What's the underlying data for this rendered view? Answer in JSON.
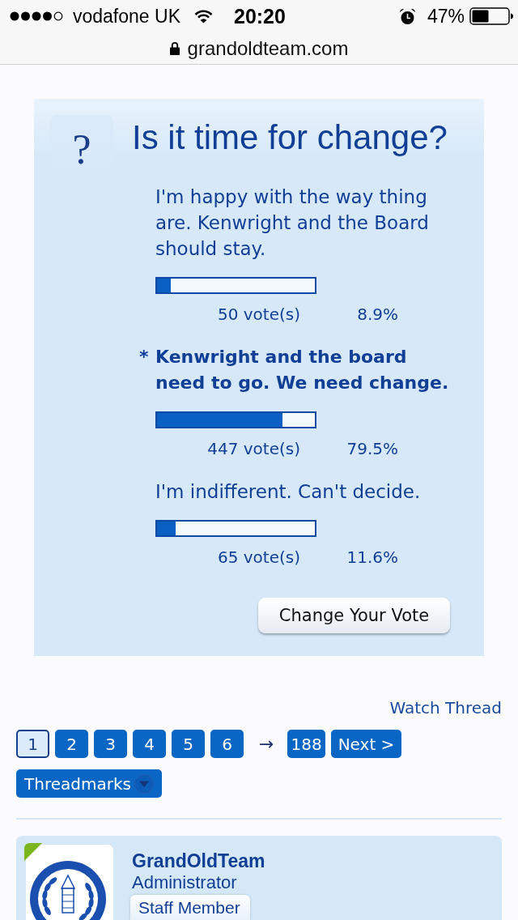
{
  "status_bar": {
    "carrier": "vodafone UK",
    "time": "20:20",
    "battery": "47%"
  },
  "address_bar": {
    "url": "grandoldteam.com"
  },
  "poll": {
    "icon": "?",
    "title": "Is it time for change?",
    "voted_marker": "*",
    "options": [
      {
        "text": "I'm happy with the way thing are. Kenwright and the Board should stay.",
        "selected": false,
        "level": 0.089,
        "votes": "50 vote(s)",
        "percent": "8.9%"
      },
      {
        "text": "Kenwright and the board need to go. We need change.",
        "selected": true,
        "level": 0.795,
        "votes": "447 vote(s)",
        "percent": "79.5%"
      },
      {
        "text": "I'm indifferent. Can't decide.",
        "selected": false,
        "level": 0.116,
        "votes": "65 vote(s)",
        "percent": "11.6%"
      }
    ],
    "button": "Change Your Vote"
  },
  "thread_tools": {
    "watch": "Watch Thread"
  },
  "pagination": {
    "pages": [
      {
        "label": "1",
        "selected": true
      },
      {
        "label": "2",
        "selected": false
      },
      {
        "label": "3",
        "selected": false
      },
      {
        "label": "4",
        "selected": false
      },
      {
        "label": "5",
        "selected": false
      },
      {
        "label": "6",
        "selected": false
      }
    ],
    "gap": "→",
    "last": {
      "label": "188",
      "selected": false
    },
    "next": "Next >"
  },
  "threadmarks": {
    "label": "Threadmarks"
  },
  "post": {
    "author": "GrandOldTeam",
    "user_title": "Administrator",
    "banner": "Staff Member",
    "online": true
  }
}
